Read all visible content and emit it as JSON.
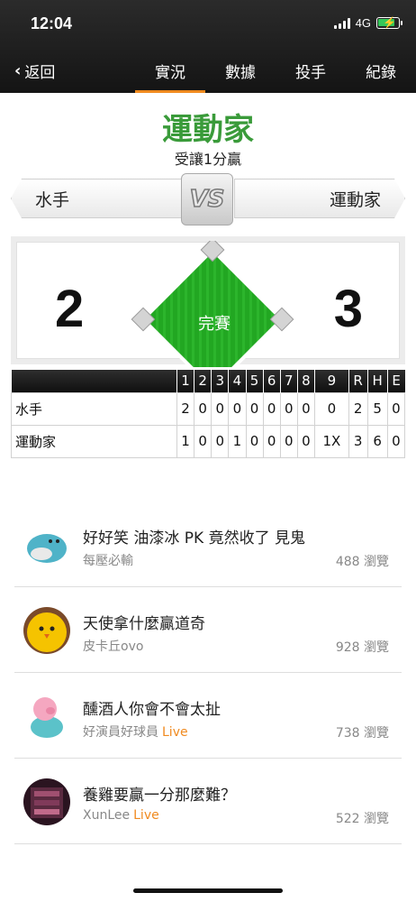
{
  "status_bar": {
    "time": "12:04",
    "network": "4G"
  },
  "nav": {
    "back_label": "返回",
    "tabs": [
      {
        "label": "實況",
        "active": true
      },
      {
        "label": "數據",
        "active": false
      },
      {
        "label": "投手",
        "active": false
      },
      {
        "label": "紀錄",
        "active": false
      }
    ]
  },
  "game": {
    "winner": "運動家",
    "handicap": "受讓1分贏",
    "away_team": "水手",
    "home_team": "運動家",
    "vs_label": "VS",
    "away_score": "2",
    "home_score": "3",
    "status": "完賽"
  },
  "boxscore": {
    "headers": [
      "1",
      "2",
      "3",
      "4",
      "5",
      "6",
      "7",
      "8",
      "9",
      "R",
      "H",
      "E"
    ],
    "rows": [
      {
        "team": "水手",
        "cells": [
          "2",
          "0",
          "0",
          "0",
          "0",
          "0",
          "0",
          "0",
          "0",
          "2",
          "5",
          "0"
        ]
      },
      {
        "team": "運動家",
        "cells": [
          "1",
          "0",
          "0",
          "1",
          "0",
          "0",
          "0",
          "0",
          "1X",
          "3",
          "6",
          "0"
        ]
      }
    ]
  },
  "feed": [
    {
      "title": "好好笑 油漆冰 PK 竟然收了 見鬼",
      "author": "每壓必輸",
      "live": "",
      "views": "488 瀏覽",
      "avatar": "seal-avatar"
    },
    {
      "title": "天使拿什麼贏道奇",
      "author": "皮卡丘ovo",
      "live": "",
      "views": "928 瀏覽",
      "avatar": "chick-avatar"
    },
    {
      "title": "醺酒人你會不會太扯",
      "author": "好演員好球員",
      "live": "Live",
      "views": "738 瀏覽",
      "avatar": "pig-avatar"
    },
    {
      "title": "養雞要贏一分那麼難？",
      "author": "XunLee",
      "live": "Live",
      "views": "522 瀏覽",
      "avatar": "photo-avatar"
    }
  ],
  "colors": {
    "accent": "#f08a1f",
    "win_green": "#3a9b3a",
    "field_green": "#22a722"
  }
}
